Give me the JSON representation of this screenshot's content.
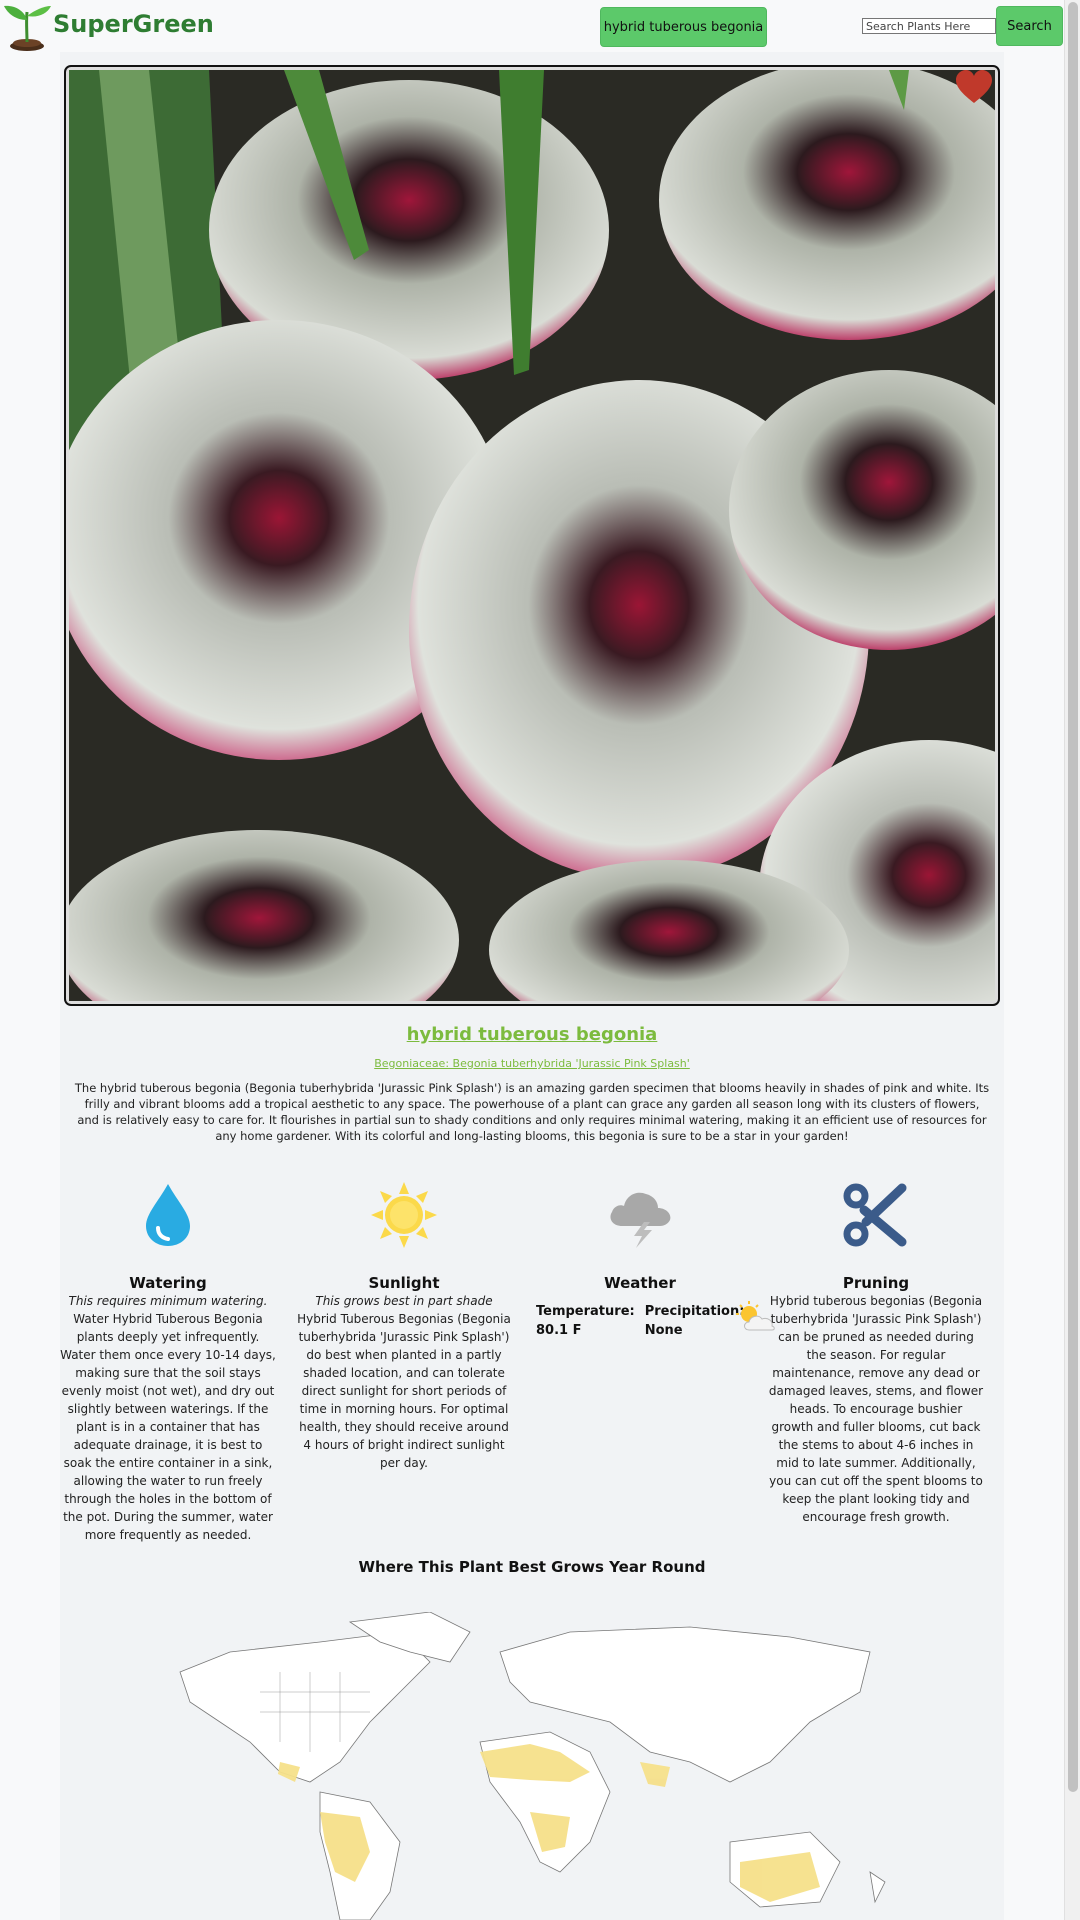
{
  "header": {
    "brand": "SuperGreen",
    "current_plant": "hybrid tuberous begonia",
    "search_placeholder": "Search Plants Here",
    "search_button": "Search"
  },
  "plant": {
    "name": "hybrid tuberous begonia",
    "scientific": "Begoniaceae: Begonia tuberhybrida 'Jurassic Pink Splash'",
    "description": "The hybrid tuberous begonia (Begonia tuberhybrida 'Jurassic Pink Splash') is an amazing garden specimen that blooms heavily in shades of pink and white. Its frilly and vibrant blooms add a tropical aesthetic to any space. The powerhouse of a plant can grace any garden all season long with its clusters of flowers, and is relatively easy to care for. It flourishes in partial sun to shady conditions and only requires minimal watering, making it an efficient use of resources for any home gardener. With its colorful and long-lasting blooms, this begonia is sure to be a star in your garden!"
  },
  "care": {
    "watering": {
      "title": "Watering",
      "summary": "This requires minimum watering.",
      "body": "Water Hybrid Tuberous Begonia plants deeply yet infrequently. Water them once every 10-14 days, making sure that the soil stays evenly moist (not wet), and dry out slightly between waterings. If the plant is in a container that has adequate drainage, it is best to soak the entire container in a sink, allowing the water to run freely through the holes in the bottom of the pot. During the summer, water more frequently as needed.",
      "icon": "water-drop-icon"
    },
    "sunlight": {
      "title": "Sunlight",
      "summary": "This grows best in part shade",
      "body": "Hybrid Tuberous Begonias (Begonia tuberhybrida 'Jurassic Pink Splash') do best when planted in a partly shaded location, and can tolerate direct sunlight for short periods of time in morning hours. For optimal health, they should receive around 4 hours of bright indirect sunlight per day.",
      "icon": "sun-icon"
    },
    "weather": {
      "title": "Weather",
      "temp_label": "Temperature:",
      "temp_value": "80.1 F",
      "precip_label": "Precipitation:",
      "precip_value": "None",
      "icon": "storm-cloud-icon",
      "small_icon": "partly-cloudy-icon"
    },
    "pruning": {
      "title": "Pruning",
      "body": "Hybrid tuberous begonias (Begonia tuberhybrida 'Jurassic Pink Splash') can be pruned as needed during the season. For regular maintenance, remove any dead or damaged leaves, stems, and flower heads. To encourage bushier growth and fuller blooms, cut back the stems to about 4-6 inches in mid to late summer. Additionally, you can cut off the spent blooms to keep the plant looking tidy and encourage fresh growth.",
      "icon": "scissors-icon"
    }
  },
  "map": {
    "title": "Where This Plant Best Grows Year Round"
  },
  "colors": {
    "accent_green": "#5cc96a",
    "title_green": "#7cbb3e",
    "heart_red": "#c0392b",
    "map_highlight": "#f6e08a"
  }
}
